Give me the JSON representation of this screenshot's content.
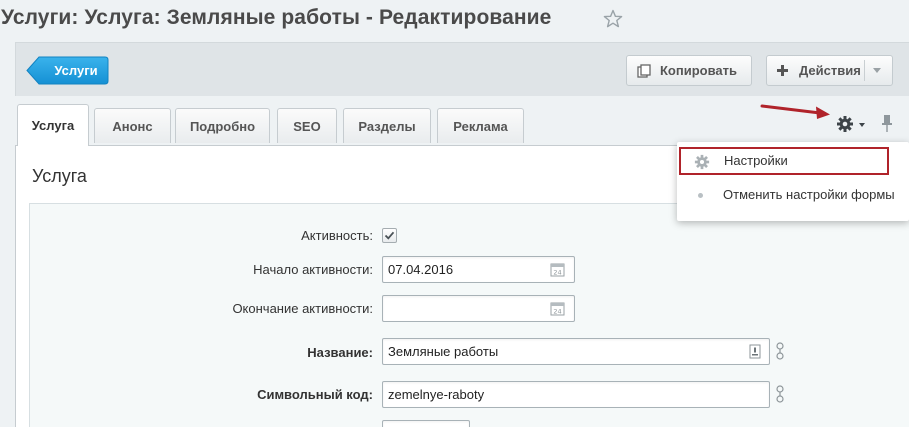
{
  "header": {
    "title": "Услуги: Услуга: Земляные работы - Редактирование"
  },
  "toolbar": {
    "back_label": "Услуги",
    "copy_label": "Копировать",
    "actions_label": "Действия"
  },
  "tabs": [
    {
      "label": "Услуга"
    },
    {
      "label": "Анонс"
    },
    {
      "label": "Подробно"
    },
    {
      "label": "SEO"
    },
    {
      "label": "Разделы"
    },
    {
      "label": "Реклама"
    }
  ],
  "section": {
    "title": "Услуга"
  },
  "form": {
    "active_label": "Активность:",
    "active_checked": true,
    "start_label": "Начало активности:",
    "start_value": "07.04.2016",
    "end_label": "Окончание активности:",
    "end_value": "",
    "name_label": "Название:",
    "name_value": "Земляные работы",
    "code_label": "Символьный код:",
    "code_value": "zemelnye-raboty"
  },
  "settings_menu": {
    "items": [
      {
        "label": "Настройки"
      },
      {
        "label": "Отменить настройки формы"
      }
    ]
  },
  "colors": {
    "accent_blue": "#1a9ee0",
    "annotation_red": "#b0232a"
  }
}
